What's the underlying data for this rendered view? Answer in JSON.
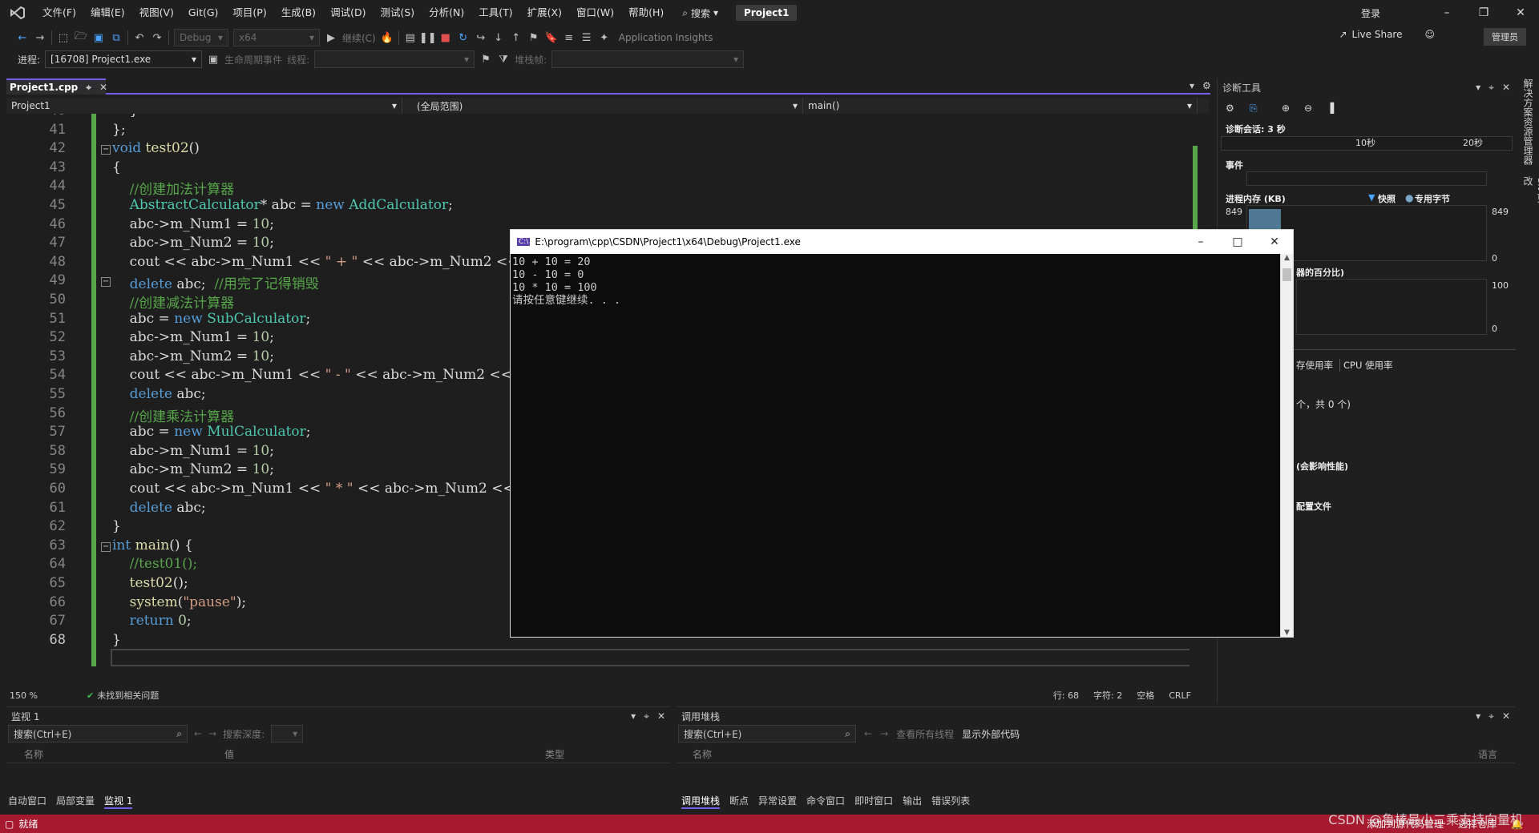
{
  "menubar": {
    "items": [
      "文件(F)",
      "编辑(E)",
      "视图(V)",
      "Git(G)",
      "项目(P)",
      "生成(B)",
      "调试(D)",
      "测试(S)",
      "分析(N)",
      "工具(T)",
      "扩展(X)",
      "窗口(W)",
      "帮助(H)"
    ],
    "search_label": "搜索",
    "project_badge": "Project1",
    "login": "登录"
  },
  "toolbar": {
    "config": "Debug",
    "platform": "x64",
    "continue_label": "继续(C)",
    "app_insights": "Application Insights",
    "live_share": "Live Share",
    "admin": "管理员"
  },
  "toolbar2": {
    "process_label": "进程:",
    "process_value": "[16708] Project1.exe",
    "lifecycle_label": "生命周期事件",
    "thread_label": "线程:",
    "stack_label": "堆栈帧:"
  },
  "tab": {
    "active": "Project1.cpp"
  },
  "nav": {
    "project": "Project1",
    "scope": "(全局范围)",
    "member": "main()"
  },
  "editor": {
    "lines": [
      {
        "n": "40",
        "html": "    }"
      },
      {
        "n": "41",
        "html": "};"
      },
      {
        "n": "42",
        "html": "<span class='kw'>void</span> <span class='fn'>test02</span>()"
      },
      {
        "n": "43",
        "html": "{"
      },
      {
        "n": "44",
        "html": "    <span class='cm'>//创建加法计算器</span>"
      },
      {
        "n": "45",
        "html": "    <span class='ty'>AbstractCalculator</span>* abc = <span class='kw'>new</span> <span class='ty'>AddCalculator</span>;"
      },
      {
        "n": "46",
        "html": "    abc-&gt;m_Num1 = <span class='num'>10</span>;"
      },
      {
        "n": "47",
        "html": "    abc-&gt;m_Num2 = <span class='num'>10</span>;"
      },
      {
        "n": "48",
        "html": "    cout &lt;&lt; abc-&gt;m_Num1 &lt;&lt; <span class='str'>\" + \"</span> &lt;&lt; abc-&gt;m_Num2 &lt;&lt;"
      },
      {
        "n": "49",
        "html": "    <span class='kw'>delete</span> abc;  <span class='cm'>//用完了记得销毁</span>"
      },
      {
        "n": "50",
        "html": "    <span class='cm'>//创建减法计算器</span>"
      },
      {
        "n": "51",
        "html": "    abc = <span class='kw'>new</span> <span class='ty'>SubCalculator</span>;"
      },
      {
        "n": "52",
        "html": "    abc-&gt;m_Num1 = <span class='num'>10</span>;"
      },
      {
        "n": "53",
        "html": "    abc-&gt;m_Num2 = <span class='num'>10</span>;"
      },
      {
        "n": "54",
        "html": "    cout &lt;&lt; abc-&gt;m_Num1 &lt;&lt; <span class='str'>\" - \"</span> &lt;&lt; abc-&gt;m_Num2 &lt;&lt;"
      },
      {
        "n": "55",
        "html": "    <span class='kw'>delete</span> abc;"
      },
      {
        "n": "56",
        "html": "    <span class='cm'>//创建乘法计算器</span>"
      },
      {
        "n": "57",
        "html": "    abc = <span class='kw'>new</span> <span class='ty'>MulCalculator</span>;"
      },
      {
        "n": "58",
        "html": "    abc-&gt;m_Num1 = <span class='num'>10</span>;"
      },
      {
        "n": "59",
        "html": "    abc-&gt;m_Num2 = <span class='num'>10</span>;"
      },
      {
        "n": "60",
        "html": "    cout &lt;&lt; abc-&gt;m_Num1 &lt;&lt; <span class='str'>\" * \"</span> &lt;&lt; abc-&gt;m_Num2 &lt;&lt;"
      },
      {
        "n": "61",
        "html": "    <span class='kw'>delete</span> abc;"
      },
      {
        "n": "62",
        "html": "}"
      },
      {
        "n": "63",
        "html": "<span class='kw'>int</span> <span class='fn'>main</span>() {"
      },
      {
        "n": "64",
        "html": "    <span class='cm'>//test01();</span>"
      },
      {
        "n": "65",
        "html": "    <span class='fn'>test02</span>();"
      },
      {
        "n": "66",
        "html": "    <span class='fn'>system</span>(<span class='str'>\"pause\"</span>);"
      },
      {
        "n": "67",
        "html": "    <span class='kw'>return</span> <span class='num'>0</span>;"
      },
      {
        "n": "68",
        "html": "}"
      }
    ],
    "zoom": "150 %",
    "issues": "未找到相关问题",
    "row": "行: 68",
    "col": "字符: 2",
    "ws": "空格",
    "eol": "CRLF"
  },
  "console": {
    "title": "E:\\program\\cpp\\CSDN\\Project1\\x64\\Debug\\Project1.exe",
    "output": "10 + 10 = 20\n10 - 10 = 0\n10 * 10 = 100\n请按任意键继续. . ."
  },
  "diag": {
    "title": "诊断工具",
    "session": "诊断会话: 3 秒",
    "t10": "10秒",
    "t20": "20秒",
    "events": "事件",
    "memory": "进程内存 (KB)",
    "snapshot": "快照",
    "private": "专用字节",
    "mem_max_left": "849",
    "mem_max_right": "849",
    "mem_zero": "0",
    "cpu_partial": "器的百分比)",
    "cpu_max": "100",
    "cpu_zero": "0",
    "tab_mem": "存使用率",
    "tab_cpu": "CPU 使用率",
    "count_text": "个，共 0 个)",
    "perf_text": "(会影响性能)",
    "profile_text": "配置文件"
  },
  "side": {
    "a": "解决方案资源管理器",
    "b": "Git 更改"
  },
  "watch": {
    "title": "监视 1",
    "search": "搜索(Ctrl+E)",
    "depth": "搜索深度:",
    "col_name": "名称",
    "col_value": "值",
    "col_type": "类型",
    "tabs": [
      "自动窗口",
      "局部变量",
      "监视 1"
    ]
  },
  "callstack": {
    "title": "调用堆栈",
    "search": "搜索(Ctrl+E)",
    "view_threads": "查看所有线程",
    "show_external": "显示外部代码",
    "col_name": "名称",
    "col_lang": "语言",
    "tabs": [
      "调用堆栈",
      "断点",
      "异常设置",
      "命令窗口",
      "即时窗口",
      "输出",
      "错误列表"
    ]
  },
  "status": {
    "ready": "就绪",
    "add_source": "添加到源代码管理",
    "select_repo": "选择仓库"
  },
  "watermark": "CSDN @鲁棒最小二乘支持向量机"
}
